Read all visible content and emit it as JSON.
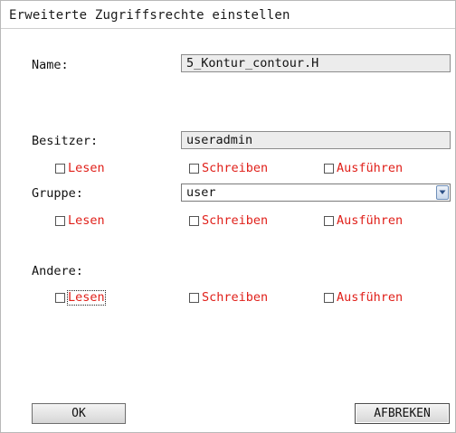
{
  "dialog": {
    "title": "Erweiterte Zugriffsrechte einstellen"
  },
  "name": {
    "label": "Name:",
    "value": "5_Kontur_contour.H"
  },
  "owner": {
    "label": "Besitzer:",
    "value": "useradmin",
    "read": "Lesen",
    "write": "Schreiben",
    "execute": "Ausführen"
  },
  "group": {
    "label": "Gruppe:",
    "value": "user",
    "read": "Lesen",
    "write": "Schreiben",
    "execute": "Ausführen"
  },
  "others": {
    "label": "Andere:",
    "read": "Lesen",
    "write": "Schreiben",
    "execute": "Ausführen"
  },
  "buttons": {
    "ok": "OK",
    "cancel": "AFBREKEN"
  },
  "colors": {
    "permission_text": "#e0201a",
    "field_background": "#ececec"
  }
}
